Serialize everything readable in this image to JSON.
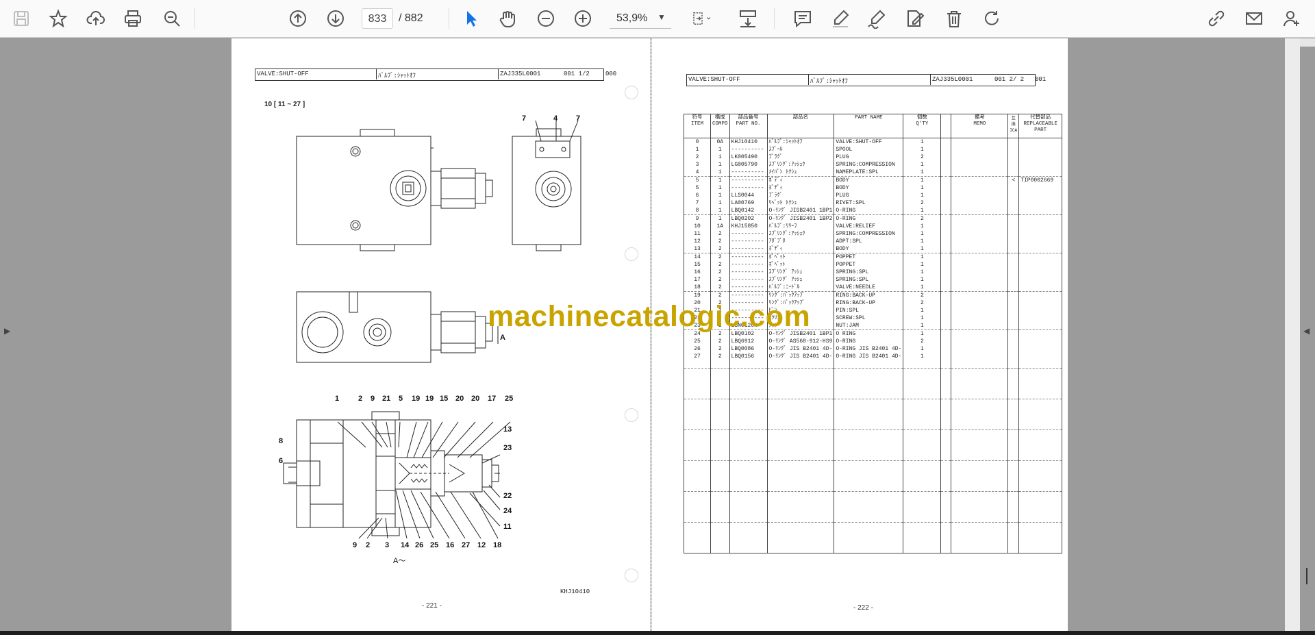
{
  "toolbar": {
    "current_page": "833",
    "total_pages": "/ 882",
    "zoom": "53,9%",
    "icons": [
      "save-icon",
      "bookmark-star-icon",
      "upload-icon",
      "print-icon",
      "zoom-search-icon",
      "prev-page-icon",
      "next-page-icon",
      "select-cursor-icon",
      "hand-tool-icon",
      "zoom-out-icon",
      "zoom-in-icon",
      "fit-page-icon",
      "scroll-mode-icon",
      "comment-icon",
      "highlight-pen-icon",
      "sign-icon",
      "edit-pdf-icon",
      "delete-icon",
      "rotate-icon",
      "share-link-icon",
      "email-icon",
      "add-user-icon"
    ]
  },
  "left_page": {
    "header_name": "VALVE:SHUT-OFF",
    "header_jp": "ﾊﾞﾙﾌﾞ:ｼｬｯﾄｵﾌ",
    "header_code": "ZAJ335L0001",
    "header_seq": "001  1/2",
    "header_tail": "000",
    "section": "10 [ 11 ~ 27 ]",
    "view_label": "A",
    "view_a_caption": "A～",
    "drawing_no": "KHJ10410",
    "page_number": "- 221 -",
    "callouts_top_small": [
      "7",
      "4",
      "7"
    ],
    "callouts_section_top": [
      "1",
      "2",
      "9",
      "21",
      "5",
      "19",
      "19",
      "15",
      "20",
      "20",
      "17",
      "25"
    ],
    "callouts_section_right": [
      "13",
      "23",
      "22",
      "24",
      "11"
    ],
    "callouts_section_left": [
      "8",
      "6"
    ],
    "callouts_section_bottom": [
      "9",
      "2",
      "3",
      "14",
      "26",
      "25",
      "16",
      "27",
      "12",
      "18"
    ]
  },
  "right_page": {
    "header_name": "VALVE:SHUT-OFF",
    "header_jp": "ﾊﾞﾙﾌﾞ:ｼｬｯﾄｵﾌ",
    "header_code": "ZAJ335L0001",
    "header_seq": "001  2/ 2",
    "header_tail": "001",
    "page_number": "- 222 -",
    "columns": {
      "item": "符号\nITEM",
      "comp": "構成\nCOMPO",
      "part_no": "部品番号\nPART NO.",
      "jp_name": "部品名",
      "part_name": "PART  NAME",
      "qty": "個数\nQ'TY",
      "memo": "備考\nMEMO",
      "ica": "互換\nICA",
      "replaceable": "代替部品\nREPLACEABLE\nPART"
    },
    "rows": [
      {
        "item": "0",
        "comp": "0A",
        "part_no": "KHJ10410",
        "jp": "ﾊﾞﾙﾌﾞ:ｼｬｯﾄｵﾌ",
        "name": "VALVE:SHUT-OFF",
        "qty": "1",
        "ica": "",
        "rep": ""
      },
      {
        "item": "1",
        "comp": "1",
        "part_no": "----------",
        "jp": "ｽﾌﾟｰﾙ",
        "name": "SPOOL",
        "qty": "1",
        "ica": "",
        "rep": ""
      },
      {
        "item": "2",
        "comp": "1",
        "part_no": "LK005490",
        "jp": "ﾌﾟﾗｸﾞ",
        "name": "PLUG",
        "qty": "2",
        "ica": "",
        "rep": ""
      },
      {
        "item": "3",
        "comp": "1",
        "part_no": "LG005790",
        "jp": "ｽﾌﾟﾘﾝｸﾞ:ｱｯｼｭｸ",
        "name": "SPRING:COMPRESSION",
        "qty": "1",
        "ica": "",
        "rep": ""
      },
      {
        "item": "4",
        "comp": "1",
        "part_no": "----------",
        "jp": "ﾒｲﾊﾞﾝ ﾄｸｼｭ",
        "name": "NAMEPLATE:SPL",
        "qty": "1",
        "ica": "",
        "rep": ""
      },
      {
        "item": "5",
        "comp": "1",
        "part_no": "----------",
        "jp": "ﾎﾞﾃﾞｨ",
        "name": "BODY",
        "qty": "1",
        "ica": "<",
        "rep": "TIP0002669",
        "sep": true
      },
      {
        "item": "5",
        "comp": "1",
        "part_no": "----------",
        "jp": "ﾎﾞﾃﾞｨ",
        "name": "BODY",
        "qty": "1",
        "ica": "",
        "rep": ""
      },
      {
        "item": "6",
        "comp": "1",
        "part_no": "LLS0044",
        "jp": "ﾌﾟﾗｸﾞ",
        "name": "PLUG",
        "qty": "1",
        "ica": "",
        "rep": ""
      },
      {
        "item": "7",
        "comp": "1",
        "part_no": "LA00769",
        "jp": "ﾘﾍﾞｯﾄ ﾄｸｼｭ",
        "name": "RIVET:SPL",
        "qty": "2",
        "ica": "",
        "rep": ""
      },
      {
        "item": "8",
        "comp": "1",
        "part_no": "LBQ0142",
        "jp": "O-ﾘﾝｸﾞ JISB2401 1BP1",
        "name": "O-RING",
        "qty": "1",
        "ica": "",
        "rep": ""
      },
      {
        "item": "9",
        "comp": "1",
        "part_no": "LBQ0202",
        "jp": "O-ﾘﾝｸﾞ JISB2401 1BP2",
        "name": "O-RING",
        "qty": "2",
        "ica": "",
        "rep": "",
        "sep": true
      },
      {
        "item": "10",
        "comp": "1A",
        "part_no": "KHJ15850",
        "jp": "ﾊﾞﾙﾌﾞ:ﾘﾘｰﾌ",
        "name": "VALVE:RELIEF",
        "qty": "1",
        "ica": "",
        "rep": ""
      },
      {
        "item": "11",
        "comp": "2",
        "part_no": "----------",
        "jp": "ｽﾌﾟﾘﾝｸﾞ:ｱｯｼｭｸ",
        "name": "SPRING:COMPRESSION",
        "qty": "1",
        "ica": "",
        "rep": ""
      },
      {
        "item": "12",
        "comp": "2",
        "part_no": "----------",
        "jp": "ｱﾀﾞﾌﾟﾀ",
        "name": "ADPT:SPL",
        "qty": "1",
        "ica": "",
        "rep": ""
      },
      {
        "item": "13",
        "comp": "2",
        "part_no": "----------",
        "jp": "ﾎﾞﾃﾞｨ",
        "name": "BODY",
        "qty": "1",
        "ica": "",
        "rep": ""
      },
      {
        "item": "14",
        "comp": "2",
        "part_no": "----------",
        "jp": "ﾎﾟﾍﾟｯﾄ",
        "name": "POPPET",
        "qty": "1",
        "ica": "",
        "rep": "",
        "sep": true
      },
      {
        "item": "15",
        "comp": "2",
        "part_no": "----------",
        "jp": "ﾎﾟﾍﾟｯﾄ",
        "name": "POPPET",
        "qty": "1",
        "ica": "",
        "rep": ""
      },
      {
        "item": "16",
        "comp": "2",
        "part_no": "----------",
        "jp": "ｽﾌﾟﾘﾝｸﾞ ｱｯｼｭ",
        "name": "SPRING:SPL",
        "qty": "1",
        "ica": "",
        "rep": ""
      },
      {
        "item": "17",
        "comp": "2",
        "part_no": "----------",
        "jp": "ｽﾌﾟﾘﾝｸﾞ ｱｯｼｭ",
        "name": "SPRING:SPL",
        "qty": "1",
        "ica": "",
        "rep": ""
      },
      {
        "item": "18",
        "comp": "2",
        "part_no": "----------",
        "jp": "ﾊﾞﾙﾌﾞ:ﾆｰﾄﾞﾙ",
        "name": "VALVE:NEEDLE",
        "qty": "1",
        "ica": "",
        "rep": ""
      },
      {
        "item": "19",
        "comp": "2",
        "part_no": "----------",
        "jp": "ﾘﾝｸﾞ:ﾊﾞｯｸｱｯﾌﾟ",
        "name": "RING:BACK-UP",
        "qty": "2",
        "ica": "",
        "rep": "",
        "sep": true
      },
      {
        "item": "20",
        "comp": "2",
        "part_no": "----------",
        "jp": "ﾘﾝｸﾞ:ﾊﾞｯｸｱｯﾌﾟ",
        "name": "RING:BACK-UP",
        "qty": "2",
        "ica": "",
        "rep": ""
      },
      {
        "item": "21",
        "comp": "2",
        "part_no": "----------",
        "jp": "ﾋﾟﾝ",
        "name": "PIN:SPL",
        "qty": "1",
        "ica": "",
        "rep": ""
      },
      {
        "item": "22",
        "comp": "2",
        "part_no": "----------",
        "jp": "ｽｸﾘｭｰ",
        "name": "SCREW:SPL",
        "qty": "1",
        "ica": "",
        "rep": ""
      },
      {
        "item": "23",
        "comp": "2",
        "part_no": "LSN0120N",
        "jp": "ﾅｯﾄ",
        "name": "NUT:JAM",
        "qty": "1",
        "ica": "",
        "rep": ""
      },
      {
        "item": "24",
        "comp": "2",
        "part_no": "LBQ0102",
        "jp": "O-ﾘﾝｸﾞ JISB2401 1BP1",
        "name": "O RING",
        "qty": "1",
        "ica": "",
        "rep": "",
        "sep": true
      },
      {
        "item": "25",
        "comp": "2",
        "part_no": "LBQ6912",
        "jp": "O-ﾘﾝｸﾞ AS568-912-HS9",
        "name": "O-RING",
        "qty": "2",
        "ica": "",
        "rep": ""
      },
      {
        "item": "26",
        "comp": "2",
        "part_no": "LBQ0086",
        "jp": "O-ﾘﾝｸﾞ JIS B2401 4D-",
        "name": "O-RING JIS B2401 4D-",
        "qty": "1",
        "ica": "",
        "rep": ""
      },
      {
        "item": "27",
        "comp": "2",
        "part_no": "LBQ0156",
        "jp": "O-ﾘﾝｸﾞ JIS B2401 4D-",
        "name": "O-RING JIS B2401 4D-",
        "qty": "1",
        "ica": "",
        "rep": ""
      }
    ]
  },
  "watermark": "machinecatalogic.com"
}
